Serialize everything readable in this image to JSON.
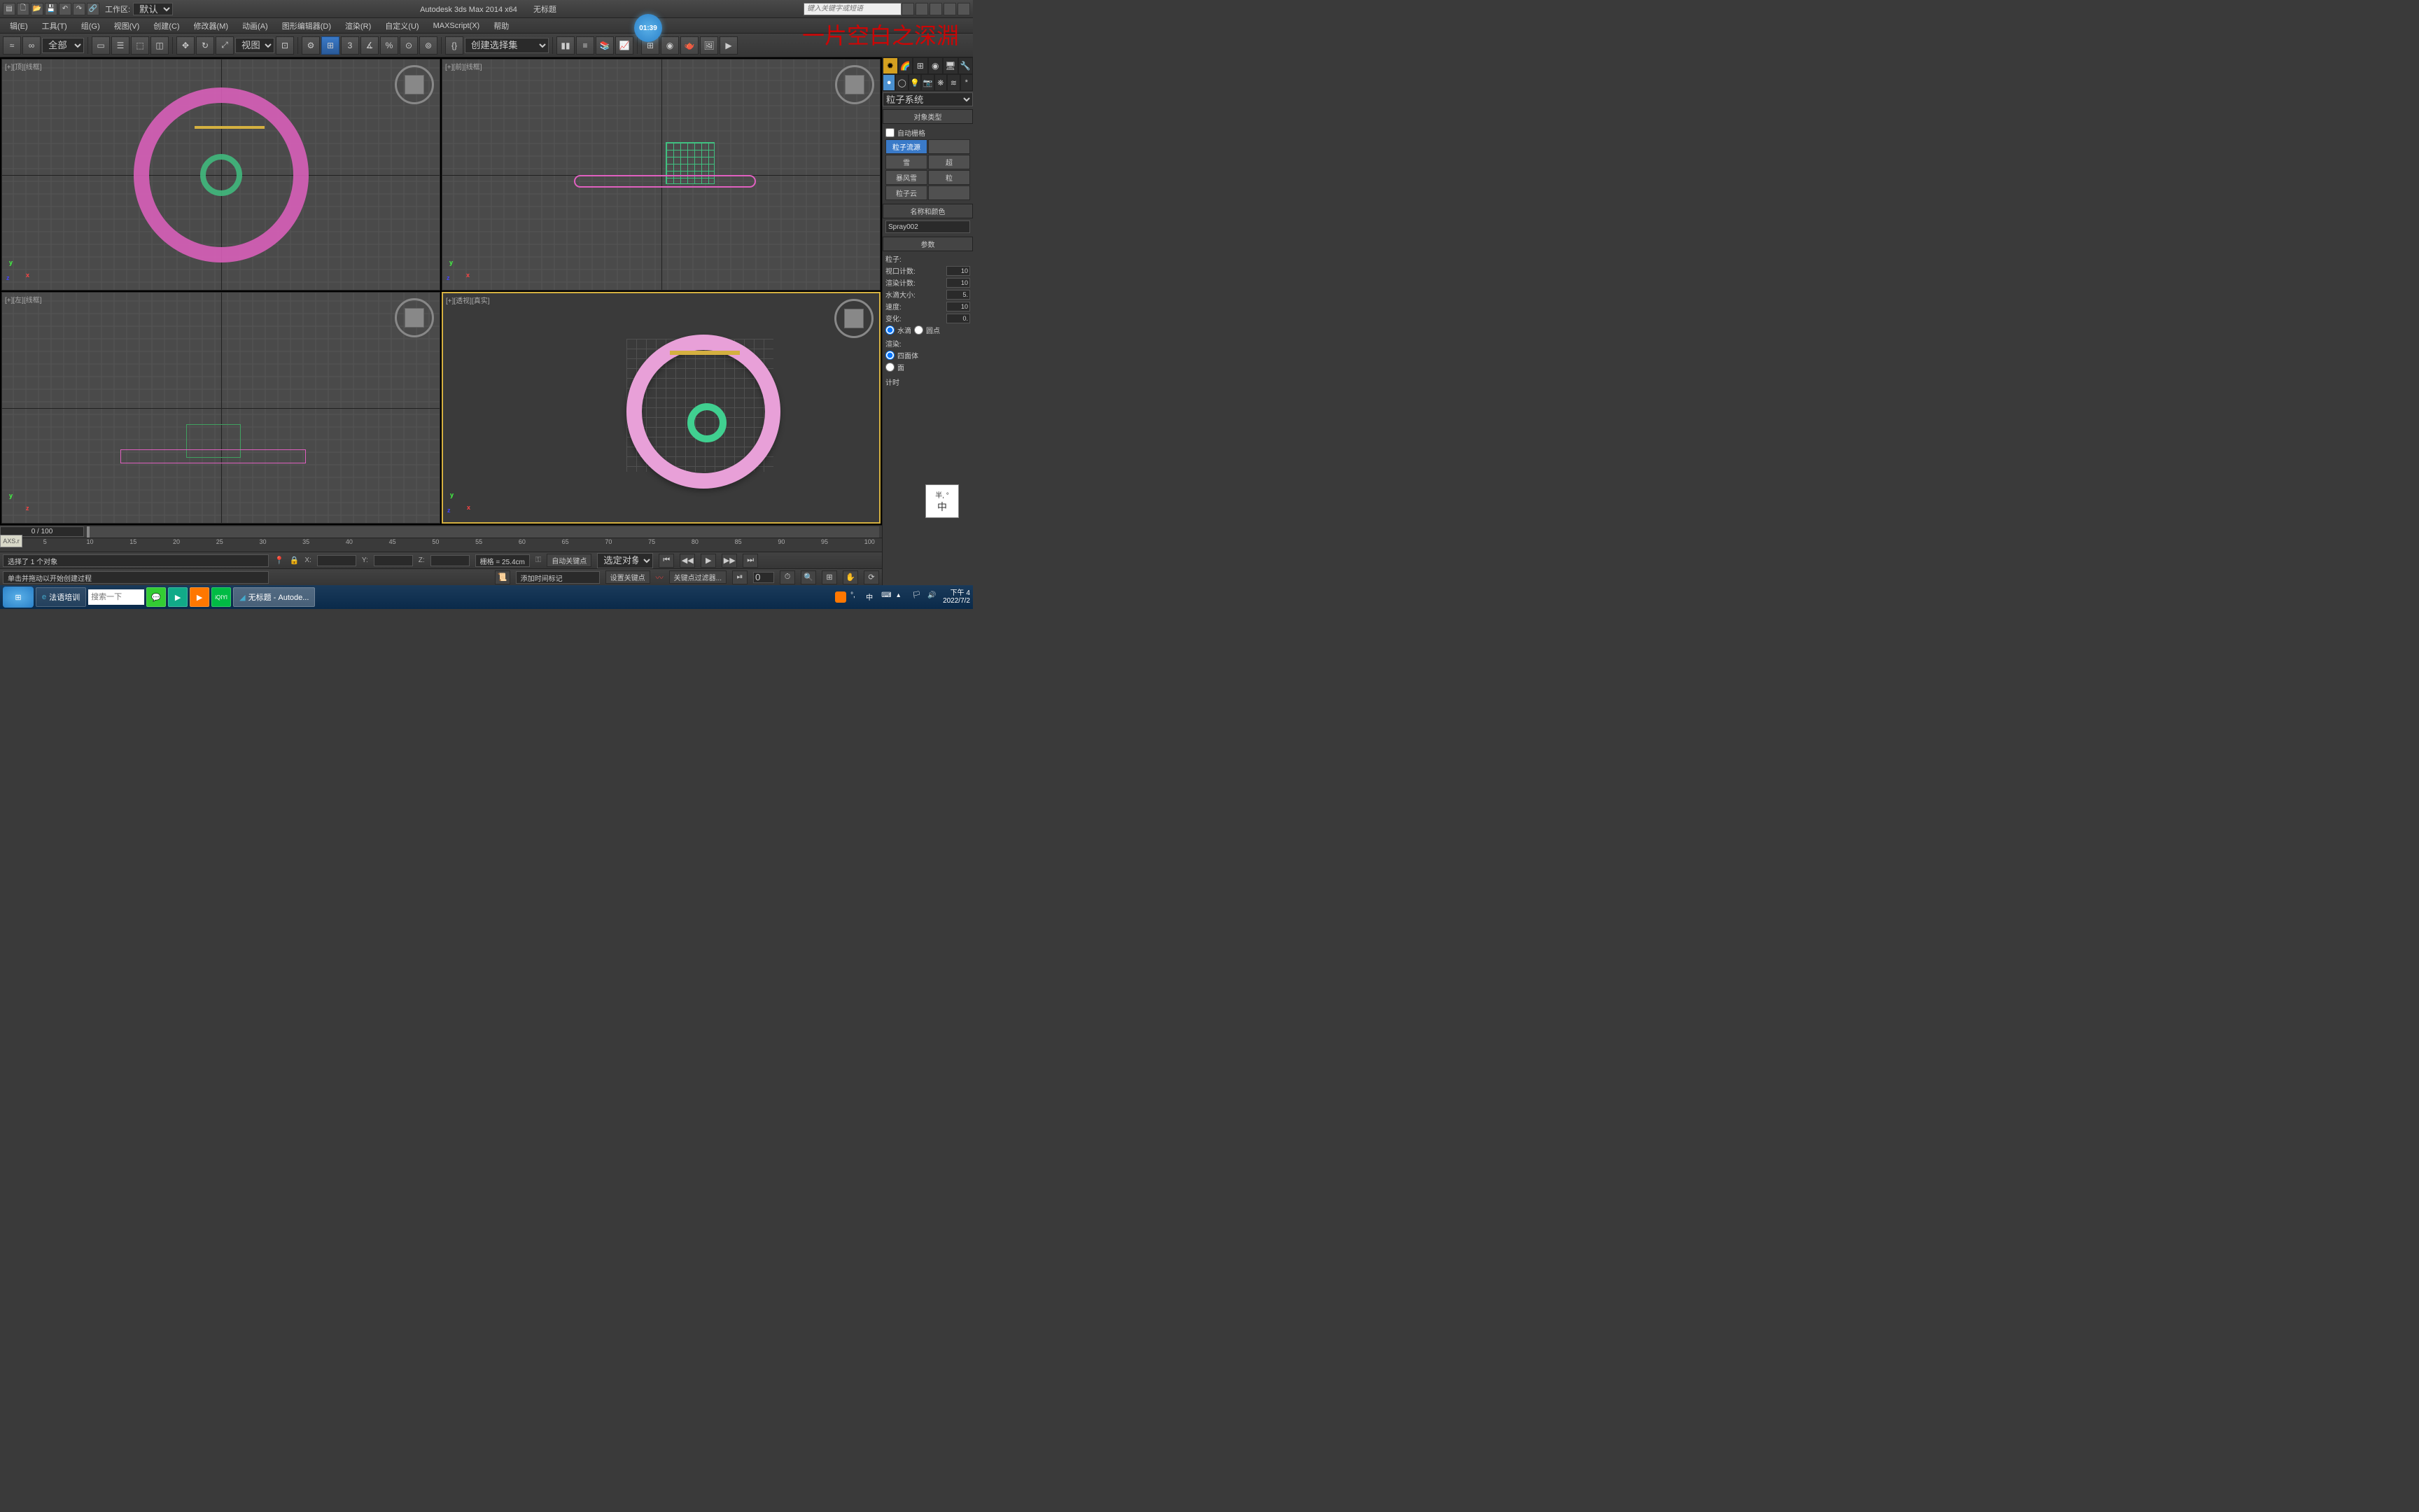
{
  "titlebar": {
    "workspace_label": "工作区:",
    "workspace_value": "默认",
    "app_title": "Autodesk 3ds Max  2014 x64",
    "doc_title": "无标题",
    "search_placeholder": "键入关键字或短语"
  },
  "menubar": {
    "items": [
      "辑(E)",
      "工具(T)",
      "组(G)",
      "视图(V)",
      "创建(C)",
      "修改器(M)",
      "动画(A)",
      "图形编辑器(D)",
      "渲染(R)",
      "自定义(U)",
      "MAXScript(X)",
      "帮助"
    ],
    "timer": "01:39",
    "watermark": "一片空白之深淵"
  },
  "toolbar": {
    "filter_value": "全部",
    "ref_value": "视图",
    "selection_set_value": "创建选择集"
  },
  "viewports": {
    "top": {
      "label": "[+][顶][线框]"
    },
    "front": {
      "label": "[+][前][线框]"
    },
    "left": {
      "label": "[+][左][线框]"
    },
    "persp": {
      "label": "[+][透视][真实]"
    }
  },
  "timeline": {
    "frame": "0 / 100",
    "ticks": [
      "0",
      "5",
      "10",
      "15",
      "20",
      "25",
      "30",
      "35",
      "40",
      "45",
      "50",
      "55",
      "60",
      "65",
      "70",
      "75",
      "80",
      "85",
      "90",
      "95",
      "100"
    ]
  },
  "status": {
    "selection": "选择了 1 个对象",
    "prompt": "单击并拖动以开始创建过程",
    "x_label": "X:",
    "y_label": "Y:",
    "z_label": "Z:",
    "grid": "栅格 = 25.4cm",
    "auto_key": "自动关键点",
    "set_key": "设置关键点",
    "sel_obj": "选定对象",
    "key_filter": "关键点过滤器...",
    "add_marker": "添加时间标记",
    "left_dock": "AXS.r"
  },
  "cmdpanel": {
    "category": "粒子系统",
    "objtype_hdr": "对象类型",
    "autogrid": "自动栅格",
    "buttons": [
      [
        "粒子流源",
        ""
      ],
      [
        "雪",
        "超"
      ],
      [
        "暴风雪",
        "粒"
      ],
      [
        "粒子云",
        ""
      ]
    ],
    "name_hdr": "名称和颜色",
    "object_name": "Spray002",
    "params_hdr": "参数",
    "particle_label": "粒子:",
    "viewport_count": "视口计数:",
    "viewport_count_val": "10",
    "render_count": "渲染计数:",
    "render_count_val": "10",
    "drop_size": "水滴大小:",
    "drop_size_val": "5.",
    "speed": "速度:",
    "speed_val": "10",
    "variation": "变化:",
    "variation_val": "0.",
    "drop": "水滴",
    "dot": "圆点",
    "render_label": "渲染:",
    "tetra": "四面体",
    "face": "面",
    "timing_hdr": "计时"
  },
  "float_badge": {
    "l1": "半, °",
    "l2": "中"
  },
  "taskbar": {
    "task1": "法语培训",
    "search_btn": "搜索一下",
    "app_task": "无标题 - Autode...",
    "time": "下午 4",
    "date": "2022/7/2"
  }
}
